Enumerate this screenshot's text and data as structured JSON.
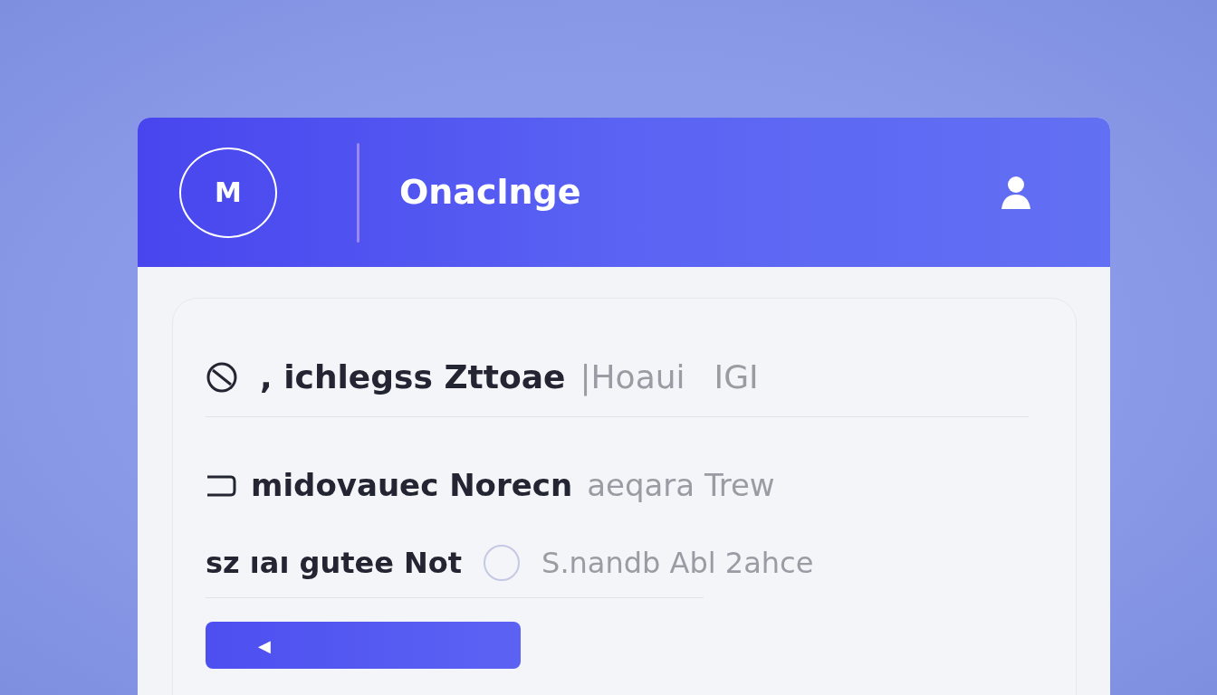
{
  "header": {
    "logo": "M",
    "title": "Onaclnge"
  },
  "rows": [
    {
      "kind": "heading",
      "primary": ", ichlegss Zttoae",
      "secondary": "|Hoaui",
      "tail": "IGI"
    },
    {
      "kind": "item",
      "primary": "midovauec Norecn",
      "secondary": "aeqara Trew"
    },
    {
      "kind": "option",
      "primary": "sz ıaı gutee Not",
      "secondary": "S.nandb Abl 2ahce",
      "checked": false
    }
  ],
  "button": {
    "label": "◀"
  }
}
